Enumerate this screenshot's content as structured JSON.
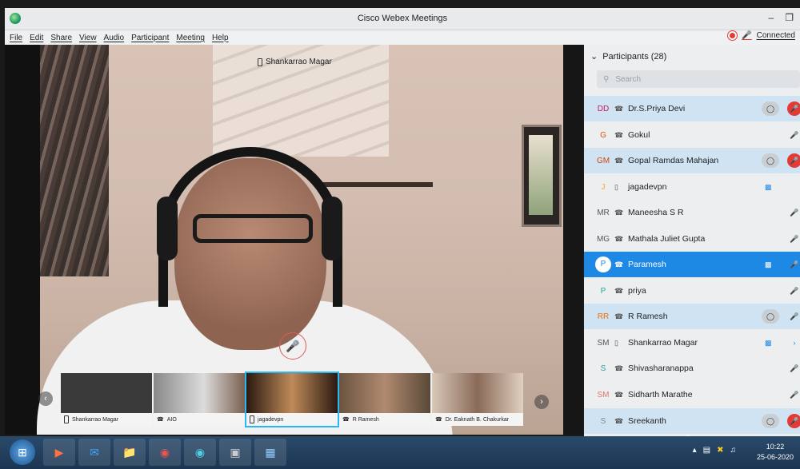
{
  "window": {
    "title": "Cisco Webex Meetings",
    "status": "Connected"
  },
  "menu": [
    "File",
    "Edit",
    "Share",
    "View",
    "Audio",
    "Participant",
    "Meeting",
    "Help"
  ],
  "main_video": {
    "speaker": "Shankarrao Magar"
  },
  "filmstrip": [
    {
      "name": "Shankarrao Magar"
    },
    {
      "name": "AIO"
    },
    {
      "name": "jagadevpn"
    },
    {
      "name": "R Ramesh"
    },
    {
      "name": "Dr. Eaknath B. Chakurkar"
    }
  ],
  "participants": {
    "header": "Participants (28)",
    "search_placeholder": "Search",
    "list": [
      {
        "initials": "DD",
        "name": "Dr.S.Priya Devi",
        "device": "audio"
      },
      {
        "initials": "G",
        "name": "Gokul",
        "device": "audio"
      },
      {
        "initials": "GM",
        "name": "Gopal Ramdas Mahajan",
        "device": "audio"
      },
      {
        "initials": "J",
        "name": "jagadevpn",
        "device": "phone"
      },
      {
        "initials": "MR",
        "name": "Maneesha S R",
        "device": "audio"
      },
      {
        "initials": "MG",
        "name": "Mathala Juliet Gupta",
        "device": "audio"
      },
      {
        "initials": "P",
        "name": "Paramesh",
        "device": "audio"
      },
      {
        "initials": "P",
        "name": "priya",
        "device": "audio"
      },
      {
        "initials": "RR",
        "name": "R Ramesh",
        "device": "audio"
      },
      {
        "initials": "SM",
        "name": "Shankarrao Magar",
        "device": "phone"
      },
      {
        "initials": "S",
        "name": "Shivasharanappa",
        "device": "audio"
      },
      {
        "initials": "SM",
        "name": "Sidharth Marathe",
        "device": "audio"
      },
      {
        "initials": "S",
        "name": "Sreekanth",
        "device": "audio"
      }
    ]
  },
  "taskbar": {
    "time": "10:22",
    "date": "25-06-2020"
  },
  "colors": {
    "accent": "#1e88e5",
    "muted_red": "#e53935",
    "highlight_row": "#cfe3f2"
  }
}
